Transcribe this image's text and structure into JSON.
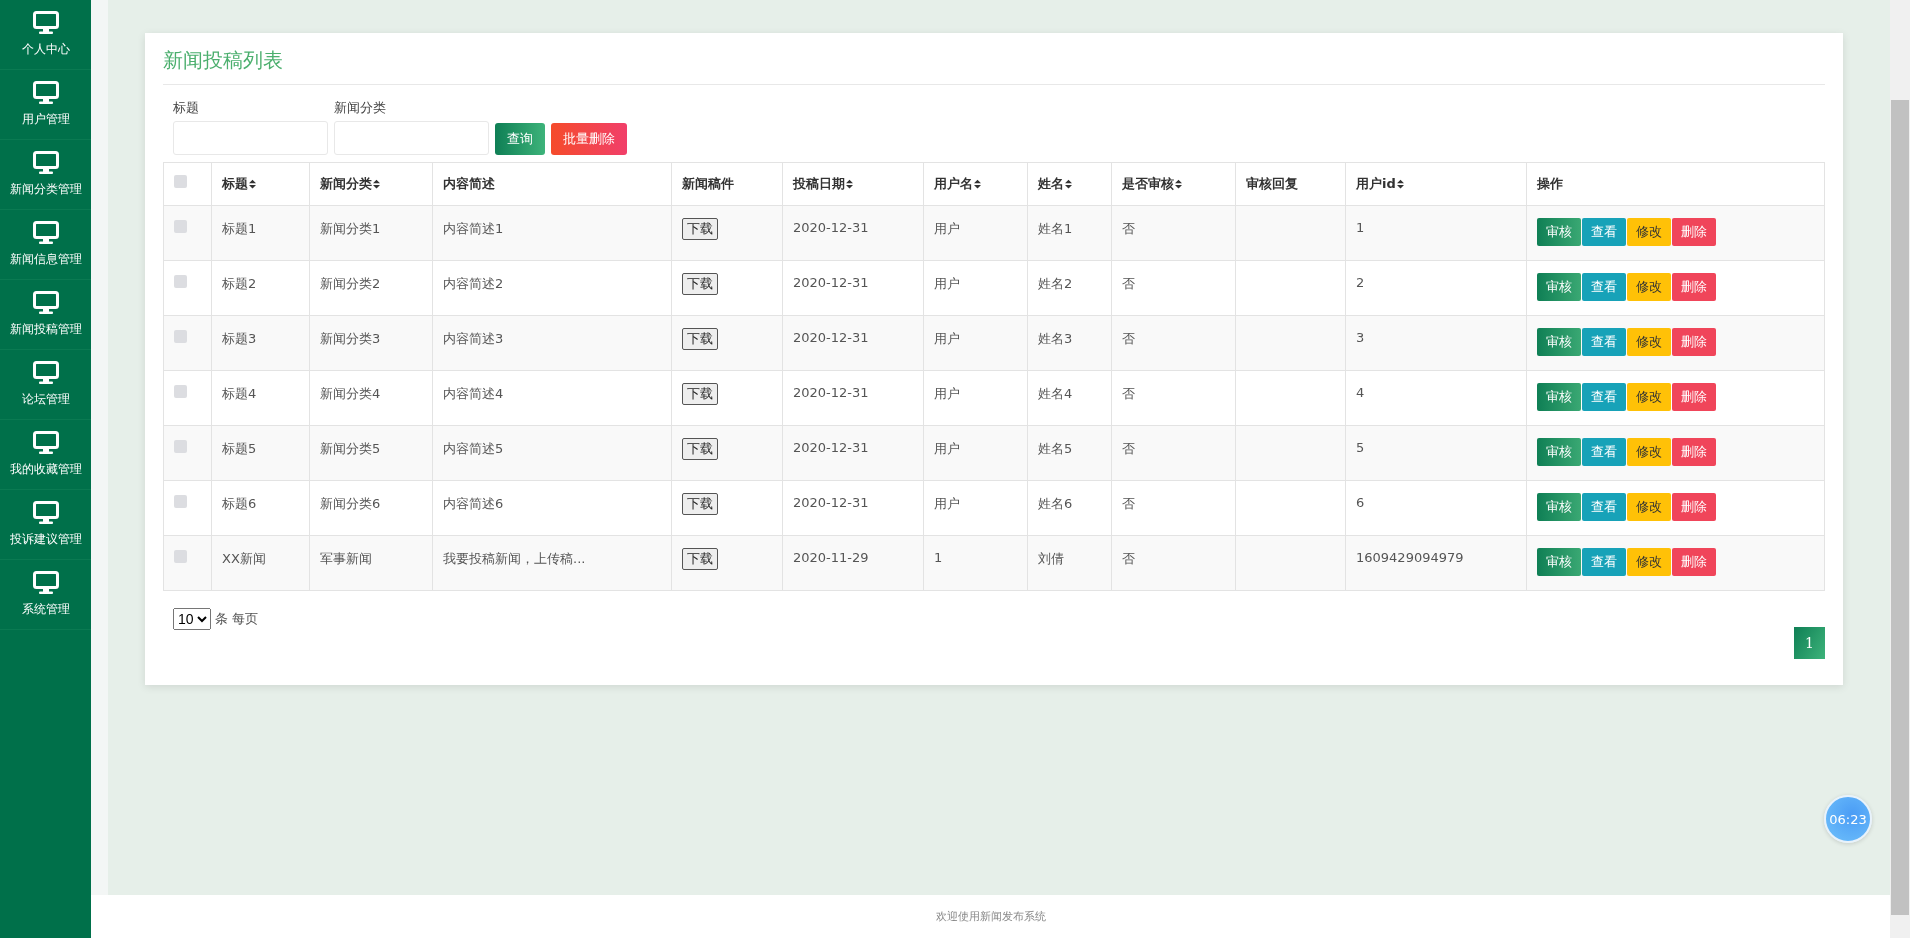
{
  "sidebar": {
    "items": [
      {
        "label": "个人中心"
      },
      {
        "label": "用户管理"
      },
      {
        "label": "新闻分类管理"
      },
      {
        "label": "新闻信息管理"
      },
      {
        "label": "新闻投稿管理"
      },
      {
        "label": "论坛管理"
      },
      {
        "label": "我的收藏管理"
      },
      {
        "label": "投诉建议管理"
      },
      {
        "label": "系统管理"
      }
    ]
  },
  "panel": {
    "title": "新闻投稿列表",
    "filters": [
      {
        "label": "标题"
      },
      {
        "label": "新闻分类"
      }
    ],
    "buttons": [
      {
        "label": "查询",
        "kind": "search"
      },
      {
        "label": "批量删除",
        "kind": "delete"
      }
    ],
    "table": {
      "select_all": {
        "checked": false
      },
      "columns": [
        {
          "label": "标题",
          "sortable": true
        },
        {
          "label": "新闻分类",
          "sortable": true
        },
        {
          "label": "内容简述",
          "sortable": false
        },
        {
          "label": "新闻稿件",
          "sortable": false
        },
        {
          "label": "投稿日期",
          "sortable": true
        },
        {
          "label": "用户名",
          "sortable": true
        },
        {
          "label": "姓名",
          "sortable": true
        },
        {
          "label": "是否审核",
          "sortable": true
        },
        {
          "label": "审核回复",
          "sortable": false
        },
        {
          "label": "用户id",
          "sortable": true
        },
        {
          "label": "操作",
          "sortable": false
        }
      ],
      "rows": [
        {
          "checked": false,
          "cells": [
            "标题1",
            "新闻分类1",
            "内容简述1",
            "下载",
            "2020-12-31",
            "用户",
            "姓名1",
            "否",
            "",
            "1"
          ],
          "actions": [
            {
              "label": "审核",
              "kind": "review"
            },
            {
              "label": "查看",
              "kind": "view"
            },
            {
              "label": "修改",
              "kind": "edit"
            },
            {
              "label": "删除",
              "kind": "delete"
            }
          ]
        },
        {
          "checked": false,
          "cells": [
            "标题2",
            "新闻分类2",
            "内容简述2",
            "下载",
            "2020-12-31",
            "用户",
            "姓名2",
            "否",
            "",
            "2"
          ],
          "actions": [
            {
              "label": "审核",
              "kind": "review"
            },
            {
              "label": "查看",
              "kind": "view"
            },
            {
              "label": "修改",
              "kind": "edit"
            },
            {
              "label": "删除",
              "kind": "delete"
            }
          ]
        },
        {
          "checked": false,
          "cells": [
            "标题3",
            "新闻分类3",
            "内容简述3",
            "下载",
            "2020-12-31",
            "用户",
            "姓名3",
            "否",
            "",
            "3"
          ],
          "actions": [
            {
              "label": "审核",
              "kind": "review"
            },
            {
              "label": "查看",
              "kind": "view"
            },
            {
              "label": "修改",
              "kind": "edit"
            },
            {
              "label": "删除",
              "kind": "delete"
            }
          ]
        },
        {
          "checked": false,
          "cells": [
            "标题4",
            "新闻分类4",
            "内容简述4",
            "下载",
            "2020-12-31",
            "用户",
            "姓名4",
            "否",
            "",
            "4"
          ],
          "actions": [
            {
              "label": "审核",
              "kind": "review"
            },
            {
              "label": "查看",
              "kind": "view"
            },
            {
              "label": "修改",
              "kind": "edit"
            },
            {
              "label": "删除",
              "kind": "delete"
            }
          ]
        },
        {
          "checked": false,
          "cells": [
            "标题5",
            "新闻分类5",
            "内容简述5",
            "下载",
            "2020-12-31",
            "用户",
            "姓名5",
            "否",
            "",
            "5"
          ],
          "actions": [
            {
              "label": "审核",
              "kind": "review"
            },
            {
              "label": "查看",
              "kind": "view"
            },
            {
              "label": "修改",
              "kind": "edit"
            },
            {
              "label": "删除",
              "kind": "delete"
            }
          ]
        },
        {
          "checked": false,
          "cells": [
            "标题6",
            "新闻分类6",
            "内容简述6",
            "下载",
            "2020-12-31",
            "用户",
            "姓名6",
            "否",
            "",
            "6"
          ],
          "actions": [
            {
              "label": "审核",
              "kind": "review"
            },
            {
              "label": "查看",
              "kind": "view"
            },
            {
              "label": "修改",
              "kind": "edit"
            },
            {
              "label": "删除",
              "kind": "delete"
            }
          ]
        },
        {
          "checked": false,
          "cells": [
            "XX新闻",
            "军事新闻",
            "我要投稿新闻，上传稿...",
            "下载",
            "2020-11-29",
            "1",
            "刘倩",
            "否",
            "",
            "1609429094979"
          ],
          "actions": [
            {
              "label": "审核",
              "kind": "review"
            },
            {
              "label": "查看",
              "kind": "view"
            },
            {
              "label": "修改",
              "kind": "edit"
            },
            {
              "label": "删除",
              "kind": "delete"
            }
          ]
        }
      ]
    },
    "page_size": {
      "value": "10",
      "suffix": "条 每页"
    },
    "pagination": [
      {
        "label": "1",
        "selected": true
      }
    ]
  },
  "clock": {
    "time": "06:23"
  },
  "footer": {
    "text": "欢迎使用新闻发布系统"
  }
}
